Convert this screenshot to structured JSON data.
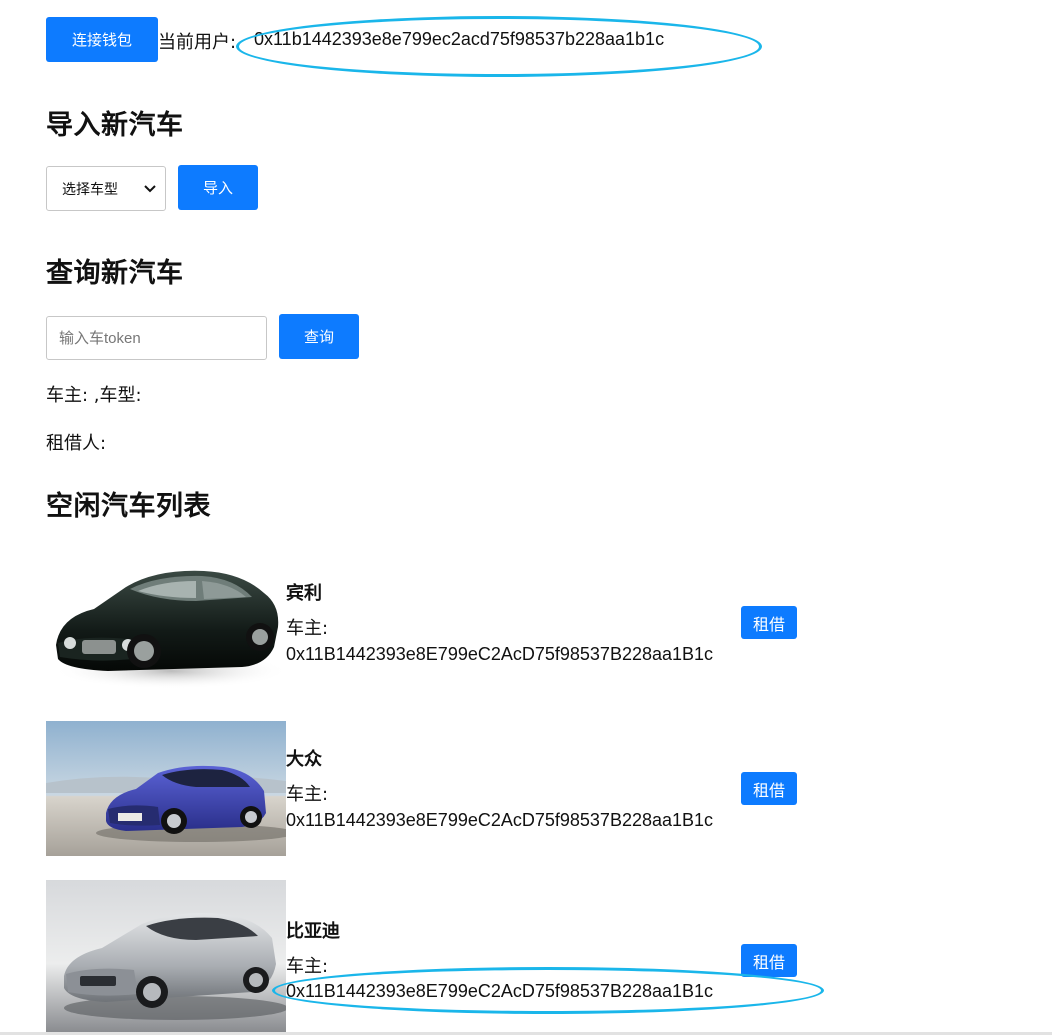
{
  "header": {
    "connect_button": "连接钱包",
    "current_user_label": "当前用户:",
    "current_user_address": "0x11b1442393e8e799ec2acd75f98537b228aa1b1c"
  },
  "import_section": {
    "title": "导入新汽车",
    "select_value": "选择车型",
    "import_button": "导入"
  },
  "query_section": {
    "title": "查询新汽车",
    "input_placeholder": "输入车token",
    "query_button": "查询",
    "owner_line": "车主: ,车型:",
    "borrower_line": "租借人:"
  },
  "car_list": {
    "title": "空闲汽车列表",
    "owner_label": "车主:",
    "rent_button": "租借",
    "cars": [
      {
        "name": "宾利",
        "owner": "0x11B1442393e8E799eC2AcD75f98537B228aa1B1c"
      },
      {
        "name": "大众",
        "owner": "0x11B1442393e8E799eC2AcD75f98537B228aa1B1c"
      },
      {
        "name": "比亚迪",
        "owner": "0x11B1442393e8E799eC2AcD75f98537B228aa1B1c"
      }
    ]
  },
  "colors": {
    "accent": "#0d7bff",
    "annotation": "#1ab6ea"
  }
}
